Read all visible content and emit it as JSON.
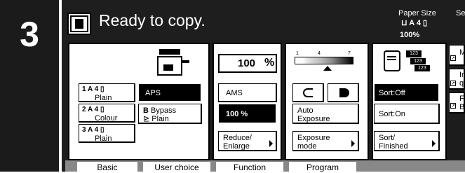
{
  "step": "3",
  "status": "Ready to copy.",
  "top_right": {
    "paper_size_label": "Paper Size",
    "se_label": "Se",
    "paper_value": "A 4",
    "zoom": "100%"
  },
  "paper_buttons": [
    {
      "num": "1",
      "size": "A 4",
      "type": "Plain"
    },
    {
      "num": "2",
      "size": "A 4",
      "type": "Colour"
    },
    {
      "num": "3",
      "size": "A 4",
      "type": "Plain"
    }
  ],
  "aps": "APS",
  "bypass": {
    "letter": "B",
    "label": "Bypass",
    "type": "Plain"
  },
  "zoom": {
    "value": "100",
    "unit": "%",
    "ams": "AMS",
    "preset": "100 %",
    "reduce_line1": "Reduce/",
    "reduce_line2": "Enlarge"
  },
  "exposure": {
    "scale_min": "1",
    "scale_mid": "4",
    "scale_max": "7",
    "auto_line1": "Auto",
    "auto_line2": "Exposure",
    "mode_line1": "Exposure",
    "mode_line2": "mode"
  },
  "sort": {
    "icon_text": "123",
    "off": "Sort:Off",
    "on": "Sort:On",
    "finished_line1": "Sort/",
    "finished_line2": "Finished"
  },
  "side_buttons": [
    {
      "top": "M",
      "bottom": ""
    },
    {
      "top": "In",
      "bottom": "q"
    },
    {
      "top": "F",
      "bottom": "B"
    }
  ],
  "tabs": [
    "Basic",
    "User choice",
    "Function",
    "Program"
  ]
}
